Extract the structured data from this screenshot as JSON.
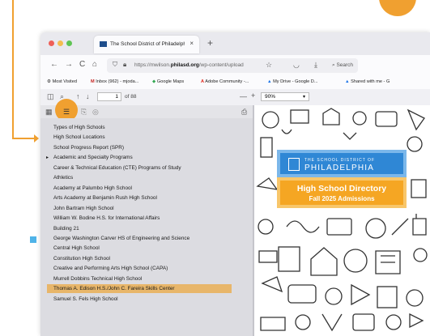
{
  "browser": {
    "tab_title": "The School District of Philadelphi",
    "tab_close": "×",
    "new_tab": "+",
    "url_prefix": "https://mwilson.",
    "url_domain": "philasd.org",
    "url_suffix": "/wp-content/upload",
    "search_label": "Search",
    "nav": {
      "back": "←",
      "forward": "→",
      "reload": "C",
      "home": "⌂"
    }
  },
  "bookmarks": [
    "Most Visited",
    "Inbox (962) - mjoda...",
    "Google Maps",
    "Adobe Community -...",
    "My Drive - Google D...",
    "Shared with me - G"
  ],
  "pdf_toolbar": {
    "page_number": "1",
    "page_count_label": "of 88",
    "zoom_minus": "—",
    "zoom_plus": "+",
    "zoom_value": "90%"
  },
  "outline": {
    "items": [
      {
        "label": "Types of High Schools",
        "bullet": ""
      },
      {
        "label": "High School Locations",
        "bullet": ""
      },
      {
        "label": "School Progress Report (SPR)",
        "bullet": ""
      },
      {
        "label": "Academic and Specialty Programs",
        "bullet": "▸"
      },
      {
        "label": "Career & Technical Education (CTE) Programs of Study",
        "bullet": ""
      },
      {
        "label": "Athletics",
        "bullet": ""
      },
      {
        "label": "Academy at Palumbo High School",
        "bullet": ""
      },
      {
        "label": "Arts Academy at Benjamin Rush High School",
        "bullet": ""
      },
      {
        "label": "John Bartram High School",
        "bullet": ""
      },
      {
        "label": "William W. Bodine H.S. for International Affairs",
        "bullet": ""
      },
      {
        "label": "Building 21",
        "bullet": ""
      },
      {
        "label": "George Washington Carver HS of Engineering and Science",
        "bullet": ""
      },
      {
        "label": "Central High School",
        "bullet": ""
      },
      {
        "label": "Constitution High School",
        "bullet": ""
      },
      {
        "label": "Creative and Performing Arts High School (CAPA)",
        "bullet": ""
      },
      {
        "label": "Murrell Dobbins Technical High School",
        "bullet": ""
      },
      {
        "label": "Thomas A. Edison H.S./John C. Fareira Skills Center",
        "bullet": ""
      },
      {
        "label": "Samuel S. Fels High School",
        "bullet": ""
      }
    ],
    "highlighted_index": 16
  },
  "document": {
    "header_small": "THE SCHOOL DISTRICT OF",
    "header_big": "PHILADELPHIA",
    "title_line1": "High School Directory",
    "title_line2": "Fall 2025 Admissions"
  },
  "colors": {
    "annotation": "#f0a030",
    "highlight": "#e8b66a",
    "header_blue": "#2f87d5",
    "title_orange": "#f5a623"
  }
}
